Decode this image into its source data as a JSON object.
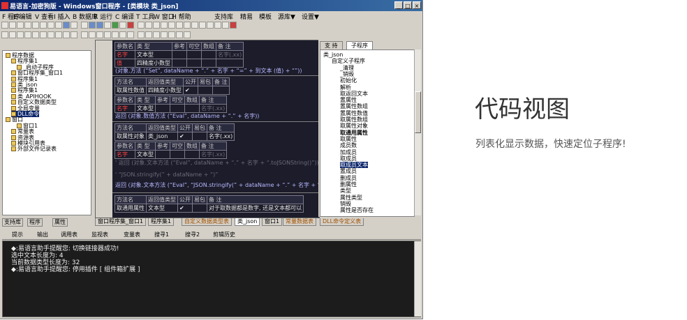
{
  "window": {
    "title": "易语言-加密狗版 - Windows窗口程序 - [类模块 类_json]"
  },
  "menu": [
    "F 程序",
    "E 编辑",
    "V 查看",
    "I 插入",
    "B 数据库",
    "R 运行",
    "C 编译",
    "T 工具",
    "W 窗口",
    "H 帮助",
    "支持库",
    "精易",
    "模板",
    "源库▼",
    "设置▼"
  ],
  "left_tree": [
    {
      "label": "程序数据",
      "indent": 0
    },
    {
      "label": "程序集1",
      "indent": 1
    },
    {
      "label": "_启动子程序",
      "indent": 2
    },
    {
      "label": "窗口程序集_窗口1",
      "indent": 1
    },
    {
      "label": "程序集1",
      "indent": 1
    },
    {
      "label": "类_json",
      "indent": 1
    },
    {
      "label": "程序集1",
      "indent": 1
    },
    {
      "label": "类_APIHOOK",
      "indent": 1
    },
    {
      "label": "自定义数据类型",
      "indent": 1
    },
    {
      "label": "全局变量",
      "indent": 1
    },
    {
      "label": "DLL命令",
      "indent": 1,
      "selected": true
    },
    {
      "label": "窗口",
      "indent": 0
    },
    {
      "label": "窗口1",
      "indent": 2
    },
    {
      "label": "常量表",
      "indent": 1
    },
    {
      "label": "资源表",
      "indent": 1
    },
    {
      "label": "模块引用表",
      "indent": 1
    },
    {
      "label": "外部文件记录表",
      "indent": 1
    }
  ],
  "left_bottom_tabs": [
    "支持库",
    "程序",
    "属性"
  ],
  "code": {
    "t1_head": [
      "参数名",
      "类 型",
      "参考",
      "可空",
      "数组",
      "备 注"
    ],
    "t1_rows": [
      [
        "名字",
        "文本型",
        "",
        "",
        "",
        "名字(.xx)"
      ],
      [
        "值",
        "四精度小数型",
        "",
        "",
        "",
        ""
      ]
    ],
    "line1": "(对象.方法 (“Set”, dataName + “.” + 名字 + “=” + 到文本 (值) + “”))",
    "t2_head": [
      "方法名",
      "返回值类型",
      "公开",
      "易包",
      "备 注"
    ],
    "t2_row": [
      "取属性数值",
      "四精度小数型",
      "✔",
      "",
      ""
    ],
    "t2_phead": [
      "参数名",
      "类 型",
      "参考",
      "可空",
      "数组",
      "备 注"
    ],
    "t2_prow": [
      "名字",
      "文本型",
      "",
      "",
      "",
      "名字(.xx)"
    ],
    "line2": "返回 (对象.数值方法 (“Eval”, dataName + “.” + 名字))",
    "t3_head": [
      "方法名",
      "返回值类型",
      "公开",
      "易包",
      "备 注"
    ],
    "t3_row": [
      "取属性对象",
      "类_json",
      "✔",
      "",
      "名字(.xx)"
    ],
    "t3_phead": [
      "参数名",
      "类 型",
      "参考",
      "可空",
      "数组",
      "备 注"
    ],
    "t3_prow": [
      "名字",
      "文本型",
      "",
      "",
      "",
      "名字(.xx)"
    ],
    "line3a": "' 返回 (对象.文本方法 (“Eval”, dataName + “.” + 名字 + “.toJSONString()”))",
    "line3b": "' “JSON.stringify(” + dataName + “)”",
    "line3c": "返回 (对象.文本方法 (“Eval”, “JSON.stringify(” + dataName + “.” + 名字 + “)”))",
    "t4_head": [
      "方法名",
      "返回值类型",
      "公开",
      "易包",
      "备 注"
    ],
    "t4_row": [
      "取通用属性",
      "文本型",
      "✔",
      "",
      "对于取数据都是数字, 还是文本都可以"
    ]
  },
  "right_panel": {
    "tabs": [
      "支 持",
      "子程序"
    ],
    "items": [
      {
        "label": "类_json",
        "indent": 0
      },
      {
        "label": "自定义子程序",
        "indent": 1
      },
      {
        "label": "_清理",
        "indent": 2
      },
      {
        "label": "_销毁",
        "indent": 2
      },
      {
        "label": "初始化",
        "indent": 2
      },
      {
        "label": "解析",
        "indent": 2
      },
      {
        "label": "取返回文本",
        "indent": 2
      },
      {
        "label": "置属性",
        "indent": 2
      },
      {
        "label": "置属性数组",
        "indent": 2
      },
      {
        "label": "置属性数值",
        "indent": 2
      },
      {
        "label": "取属性数组",
        "indent": 2
      },
      {
        "label": "取属性对象",
        "indent": 2
      },
      {
        "label": "取通用属性",
        "indent": 2,
        "bold": true
      },
      {
        "label": "取属性",
        "indent": 2
      },
      {
        "label": "成员数",
        "indent": 2
      },
      {
        "label": "加成员",
        "indent": 2
      },
      {
        "label": "取成员",
        "indent": 2
      },
      {
        "label": "取成员文本",
        "indent": 2,
        "selected": true
      },
      {
        "label": "置成员",
        "indent": 2
      },
      {
        "label": "删成员",
        "indent": 2
      },
      {
        "label": "删属性",
        "indent": 2
      },
      {
        "label": "类型",
        "indent": 2
      },
      {
        "label": "属性类型",
        "indent": 2
      },
      {
        "label": "销毁",
        "indent": 2
      },
      {
        "label": "属性是否存在",
        "indent": 2
      }
    ]
  },
  "doc_tabs": [
    "窗口程序集_窗口1",
    "程序集1",
    "自定义数据类型表",
    "类_json",
    "窗口1",
    "常量数据表",
    "DLL命令定义表"
  ],
  "output_tabs": [
    "提示",
    "输出",
    "调用表",
    "监视表",
    "变量表",
    "搜寻1",
    "搜寻2",
    "剪辑历史"
  ],
  "output_lines": [
    "◆:易语言助手提醒您: 切换链接器成功!",
    "选中文本长度为: 4",
    "当前数据类型长度为: 32",
    "◆:易语言助手提醒您: 停用插件 [ 组件箱扩展 ]"
  ],
  "promo": {
    "title": "代码视图",
    "desc": "列表化显示数据，快速定位子程序!"
  }
}
